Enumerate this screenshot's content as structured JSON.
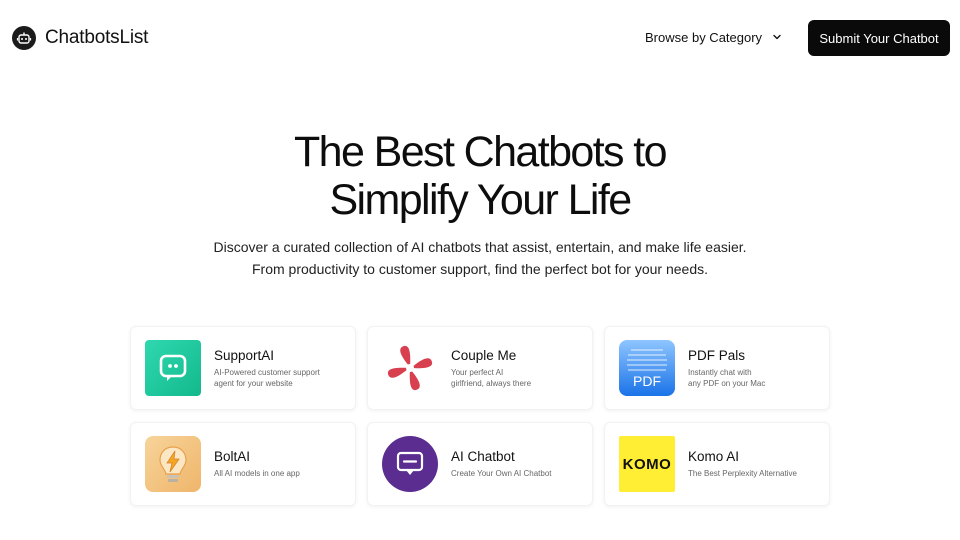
{
  "header": {
    "brand": "ChatbotsList",
    "browse_label": "Browse by Category",
    "submit_label": "Submit Your Chatbot"
  },
  "hero": {
    "title_line1": "The Best Chatbots to",
    "title_line2": "Simplify Your Life",
    "subtitle_line1": "Discover a curated collection of AI chatbots that assist, entertain, and make life easier.",
    "subtitle_line2": "From productivity to customer support, find the perfect bot for your needs."
  },
  "chatbots": [
    {
      "name": "SupportAI",
      "description": "AI-Powered customer support\nagent for your website",
      "icon": "chat-bubble-icon",
      "color": "#1fc9a0"
    },
    {
      "name": "Couple Me",
      "description": "Your perfect AI\ngirlfriend, always there",
      "icon": "hearts-knot-icon",
      "color": "#d9404f"
    },
    {
      "name": "PDF Pals",
      "description": "Instantly chat with\nany PDF on your Mac",
      "icon": "pdf-icon",
      "color": "#1a73e8"
    },
    {
      "name": "BoltAI",
      "description": "All AI models in one app",
      "icon": "lightbulb-bolt-icon",
      "color": "#f3c37a"
    },
    {
      "name": "AI Chatbot",
      "description": "Create Your Own AI Chatbot",
      "icon": "message-bubble-icon",
      "color": "#5b2d90"
    },
    {
      "name": "Komo AI",
      "description": "The Best Perplexity Alternative",
      "icon": "komo-logo",
      "logo_text": "KOMO",
      "color": "#ffee33"
    }
  ]
}
